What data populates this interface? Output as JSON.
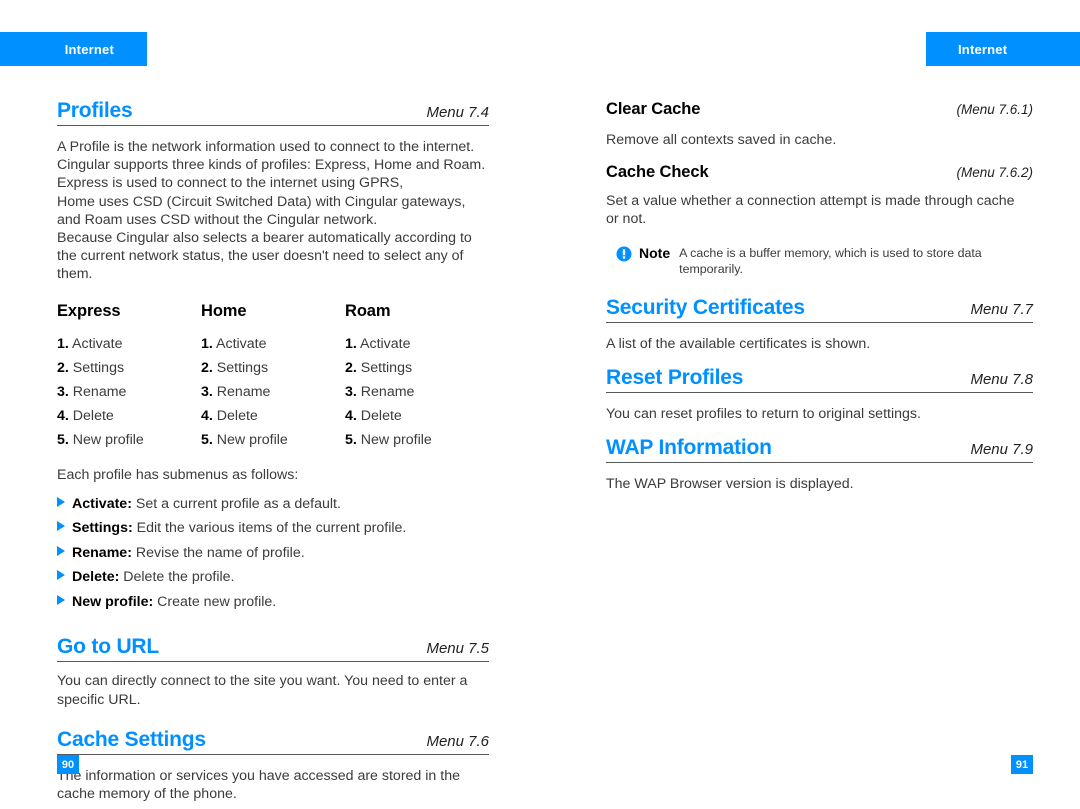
{
  "header": {
    "left_tab": "Internet",
    "right_tab": "Internet"
  },
  "colors": {
    "accent": "#0090FF",
    "heading_blue": "#0090FF",
    "body_text": "#3B3B3D",
    "rule": "#58595B"
  },
  "left_column": {
    "profiles": {
      "title": "Profiles",
      "menu": "Menu 7.4",
      "intro_lines": [
        "A Profile is the network information used to connect to the internet.",
        "Cingular supports three kinds of profiles: Express, Home and Roam.",
        "Express is used to connect to the internet using GPRS,",
        "Home uses CSD (Circuit Switched Data) with Cingular gateways,",
        "and Roam uses CSD without the Cingular network.",
        "Because Cingular also selects a bearer automatically according to",
        "the current network status, the user doesn't need to select any of",
        "them."
      ],
      "profile_table": {
        "columns": [
          {
            "header": "Express",
            "items": [
              {
                "num": "1.",
                "label": "Activate"
              },
              {
                "num": "2.",
                "label": "Settings"
              },
              {
                "num": "3.",
                "label": "Rename"
              },
              {
                "num": "4.",
                "label": "Delete"
              },
              {
                "num": "5.",
                "label": "New profile"
              }
            ]
          },
          {
            "header": "Home",
            "items": [
              {
                "num": "1.",
                "label": "Activate"
              },
              {
                "num": "2.",
                "label": "Settings"
              },
              {
                "num": "3.",
                "label": "Rename"
              },
              {
                "num": "4.",
                "label": "Delete"
              },
              {
                "num": "5.",
                "label": "New profile"
              }
            ]
          },
          {
            "header": "Roam",
            "items": [
              {
                "num": "1.",
                "label": "Activate"
              },
              {
                "num": "2.",
                "label": "Settings"
              },
              {
                "num": "3.",
                "label": "Rename"
              },
              {
                "num": "4.",
                "label": "Delete"
              },
              {
                "num": "5.",
                "label": "New profile"
              }
            ]
          }
        ]
      },
      "submenu_intro": "Each profile has submenus as follows:",
      "submenus": [
        {
          "term": "Activate:",
          "desc": "Set a current profile as a default."
        },
        {
          "term": "Settings:",
          "desc": "Edit the various items of the current profile."
        },
        {
          "term": "Rename:",
          "desc": "Revise the name of profile."
        },
        {
          "term": "Delete:",
          "desc": "Delete the profile."
        },
        {
          "term": "New profile:",
          "desc": "Create new profile."
        }
      ]
    },
    "go_to_url": {
      "title": "Go to URL",
      "menu": "Menu 7.5",
      "body_lines": [
        "You can directly connect to the site you want. You need to enter a",
        "specific URL."
      ]
    },
    "cache_settings": {
      "title": "Cache Settings",
      "menu": "Menu 7.6",
      "body_lines": [
        "The information or services you have accessed are stored in the",
        "cache memory of the phone."
      ]
    }
  },
  "right_column": {
    "clear_cache": {
      "title": "Clear Cache",
      "menu": "(Menu 7.6.1)",
      "body_lines": [
        "Remove all contexts saved in cache."
      ]
    },
    "cache_check": {
      "title": "Cache Check",
      "menu": "(Menu 7.6.2)",
      "body_lines": [
        "Set a value whether a connection attempt is made through cache",
        "or not."
      ]
    },
    "note": {
      "label": "Note",
      "lines": [
        "A cache is a buffer memory, which is used to store data",
        "temporarily."
      ]
    },
    "security_certificates": {
      "title": "Security Certificates",
      "menu": "Menu 7.7",
      "body_lines": [
        "A list of the available certificates is shown."
      ]
    },
    "reset_profiles": {
      "title": "Reset Profiles",
      "menu": "Menu 7.8",
      "body_lines": [
        "You can reset profiles to return to original settings."
      ]
    },
    "wap_information": {
      "title": "WAP Information",
      "menu": "Menu 7.9",
      "body_lines": [
        "The WAP Browser version is displayed."
      ]
    }
  },
  "footer": {
    "left_page": "90",
    "right_page": "91"
  }
}
